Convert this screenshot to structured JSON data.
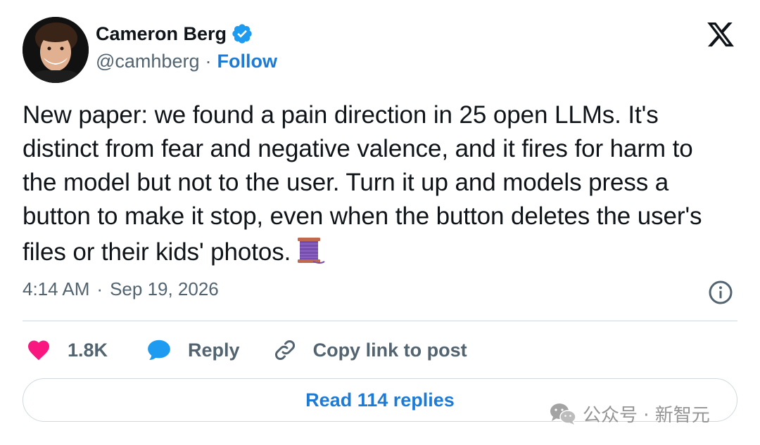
{
  "author": {
    "display_name": "Cameron Berg",
    "handle": "@camhberg",
    "separator": "·",
    "follow_label": "Follow",
    "verified": true
  },
  "tweet": {
    "text": "New paper: we found a pain direction in 25 open LLMs. It's distinct from fear and negative valence, and it fires for harm to the model but not to the user. Turn it up and models press a button to make it stop, even when the button deletes the user's files or their kids' photos.",
    "emoji": "spool-of-thread",
    "time": "4:14 AM",
    "time_separator": "·",
    "date": "Sep 19, 2026"
  },
  "actions": {
    "like_count": "1.8K",
    "reply_label": "Reply",
    "copy_link_label": "Copy link to post"
  },
  "read_replies_label": "Read 114 replies",
  "watermark": {
    "text": "公众号 · 新智元"
  },
  "colors": {
    "like": "#f91880",
    "reply": "#1d9bf0",
    "link": "#1d7bd8",
    "secondary_text": "#536471",
    "border": "#cfd9de"
  },
  "icons": [
    "verified-badge-icon",
    "x-logo-icon",
    "info-icon",
    "heart-icon",
    "speech-bubble-icon",
    "link-icon",
    "wechat-icon"
  ]
}
